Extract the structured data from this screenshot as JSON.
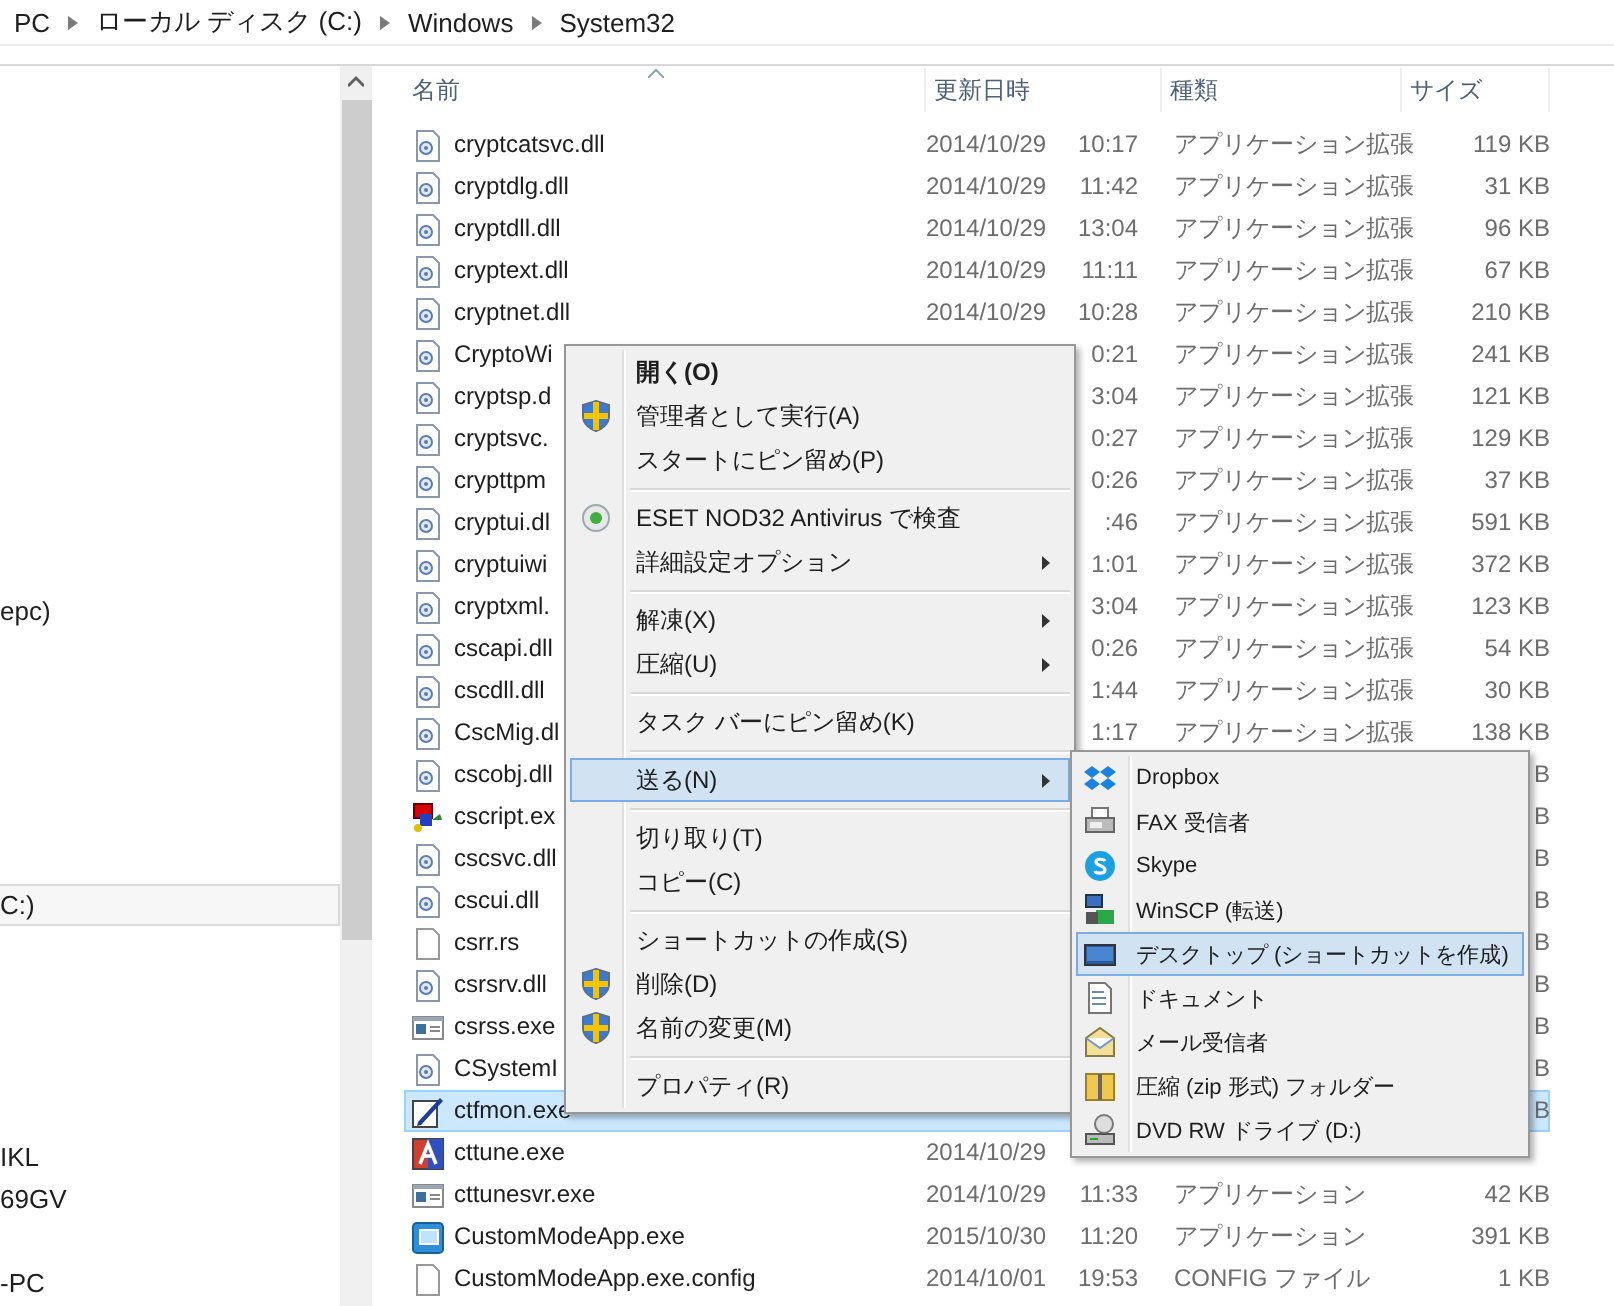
{
  "breadcrumb": [
    "PC",
    "ローカル ディスク (C:)",
    "Windows",
    "System32"
  ],
  "nav_items": [
    {
      "text": "epc)",
      "selected": false
    },
    {
      "text": "C:)",
      "selected": true
    },
    {
      "text": "IKL",
      "selected": false
    },
    {
      "text": "69GV",
      "selected": false
    },
    {
      "text": "-PC",
      "selected": false
    }
  ],
  "columns": [
    "名前",
    "更新日時",
    "種類",
    "サイズ"
  ],
  "rows": [
    {
      "kind": "dll",
      "name": "cryptcatsvc.dll",
      "day": "2014/10/29",
      "time": "10:17",
      "type": "アプリケーション拡張",
      "size": "119 KB",
      "selected": false
    },
    {
      "kind": "dll",
      "name": "cryptdlg.dll",
      "day": "2014/10/29",
      "time": "11:42",
      "type": "アプリケーション拡張",
      "size": "31 KB",
      "selected": false
    },
    {
      "kind": "dll",
      "name": "cryptdll.dll",
      "day": "2014/10/29",
      "time": "13:04",
      "type": "アプリケーション拡張",
      "size": "96 KB",
      "selected": false
    },
    {
      "kind": "dll",
      "name": "cryptext.dll",
      "day": "2014/10/29",
      "time": "11:11",
      "type": "アプリケーション拡張",
      "size": "67 KB",
      "selected": false
    },
    {
      "kind": "dll",
      "name": "cryptnet.dll",
      "day": "2014/10/29",
      "time": "10:28",
      "type": "アプリケーション拡張",
      "size": "210 KB",
      "selected": false
    },
    {
      "kind": "dll",
      "name": "CryptoWi",
      "time": "0:21",
      "type": "アプリケーション拡張",
      "size": "241 KB",
      "selected": false
    },
    {
      "kind": "dll",
      "name": "cryptsp.d",
      "time": "3:04",
      "type": "アプリケーション拡張",
      "size": "121 KB",
      "selected": false
    },
    {
      "kind": "dll",
      "name": "cryptsvc.",
      "time": "0:27",
      "type": "アプリケーション拡張",
      "size": "129 KB",
      "selected": false
    },
    {
      "kind": "dll",
      "name": "crypttpm",
      "time": "0:26",
      "type": "アプリケーション拡張",
      "size": "37 KB",
      "selected": false
    },
    {
      "kind": "dll",
      "name": "cryptui.dl",
      "time": ":46",
      "type": "アプリケーション拡張",
      "size": "591 KB",
      "selected": false
    },
    {
      "kind": "dll",
      "name": "cryptuiwi",
      "time": "1:01",
      "type": "アプリケーション拡張",
      "size": "372 KB",
      "selected": false
    },
    {
      "kind": "dll",
      "name": "cryptxml.",
      "time": "3:04",
      "type": "アプリケーション拡張",
      "size": "123 KB",
      "selected": false
    },
    {
      "kind": "dll",
      "name": "cscapi.dll",
      "time": "0:26",
      "type": "アプリケーション拡張",
      "size": "54 KB",
      "selected": false
    },
    {
      "kind": "dll",
      "name": "cscdll.dll",
      "time": "1:44",
      "type": "アプリケーション拡張",
      "size": "30 KB",
      "selected": false
    },
    {
      "kind": "dll",
      "name": "CscMig.dl",
      "time": "1:17",
      "type": "アプリケーション拡張",
      "size": "138 KB",
      "selected": false
    },
    {
      "kind": "dll",
      "name": "cscobj.dll",
      "size": "B",
      "selected": false
    },
    {
      "kind": "script",
      "name": "cscript.ex",
      "size": "B",
      "selected": false
    },
    {
      "kind": "dll",
      "name": "cscsvc.dll",
      "size": "B",
      "selected": false
    },
    {
      "kind": "dll",
      "name": "cscui.dll",
      "size": "B",
      "selected": false
    },
    {
      "kind": "blank",
      "name": "csrr.rs",
      "size": "B",
      "selected": false
    },
    {
      "kind": "dll",
      "name": "csrsrv.dll",
      "size": "B",
      "selected": false
    },
    {
      "kind": "exe",
      "name": "csrss.exe",
      "size": "B",
      "selected": false
    },
    {
      "kind": "dll",
      "name": "CSystemI",
      "size": "B",
      "selected": false
    },
    {
      "kind": "pen",
      "name": "ctfmon.exe",
      "size": "B",
      "selected": true
    },
    {
      "kind": "font",
      "name": "cttune.exe",
      "day": "2014/10/29",
      "selected": false
    },
    {
      "kind": "exe",
      "name": "cttunesvr.exe",
      "day": "2014/10/29",
      "time": "11:33",
      "type": "アプリケーション",
      "size": "42 KB",
      "selected": false
    },
    {
      "kind": "app",
      "name": "CustomModeApp.exe",
      "day": "2015/10/30",
      "time": "11:20",
      "type": "アプリケーション",
      "size": "391 KB",
      "selected": false
    },
    {
      "kind": "blank",
      "name": "CustomModeApp.exe.config",
      "day": "2014/10/01",
      "time": "19:53",
      "type": "CONFIG ファイル",
      "size": "1 KB",
      "selected": false
    }
  ],
  "context_menu": [
    {
      "kind": "plain",
      "label": "開く(O)",
      "bold": true,
      "submenu": false,
      "selected": false
    },
    {
      "kind": "shield",
      "label": "管理者として実行(A)",
      "bold": false,
      "submenu": false,
      "selected": false
    },
    {
      "kind": "plain",
      "label": "スタートにピン留め(P)",
      "bold": false,
      "submenu": false,
      "selected": false
    },
    {
      "kind": "separator"
    },
    {
      "kind": "eset",
      "label": "ESET NOD32 Antivirus で検査",
      "bold": false,
      "submenu": false,
      "selected": false
    },
    {
      "kind": "plain",
      "label": "詳細設定オプション",
      "bold": false,
      "submenu": true,
      "selected": false
    },
    {
      "kind": "separator"
    },
    {
      "kind": "plain",
      "label": "解凍(X)",
      "bold": false,
      "submenu": true,
      "selected": false
    },
    {
      "kind": "plain",
      "label": "圧縮(U)",
      "bold": false,
      "submenu": true,
      "selected": false
    },
    {
      "kind": "separator"
    },
    {
      "kind": "plain",
      "label": "タスク バーにピン留め(K)",
      "bold": false,
      "submenu": false,
      "selected": false
    },
    {
      "kind": "separator"
    },
    {
      "kind": "plain",
      "label": "送る(N)",
      "bold": false,
      "submenu": true,
      "selected": true
    },
    {
      "kind": "separator"
    },
    {
      "kind": "plain",
      "label": "切り取り(T)",
      "bold": false,
      "submenu": false,
      "selected": false
    },
    {
      "kind": "plain",
      "label": "コピー(C)",
      "bold": false,
      "submenu": false,
      "selected": false
    },
    {
      "kind": "separator"
    },
    {
      "kind": "plain",
      "label": "ショートカットの作成(S)",
      "bold": false,
      "submenu": false,
      "selected": false
    },
    {
      "kind": "shield",
      "label": "削除(D)",
      "bold": false,
      "submenu": false,
      "selected": false
    },
    {
      "kind": "shield",
      "label": "名前の変更(M)",
      "bold": false,
      "submenu": false,
      "selected": false
    },
    {
      "kind": "separator"
    },
    {
      "kind": "plain",
      "label": "プロパティ(R)",
      "bold": false,
      "submenu": false,
      "selected": false
    }
  ],
  "send_to_menu": [
    {
      "label": "Dropbox",
      "kind": "dropbox",
      "selected": false
    },
    {
      "label": "FAX 受信者",
      "kind": "fax",
      "selected": false
    },
    {
      "label": "Skype",
      "kind": "skype",
      "selected": false
    },
    {
      "label": "WinSCP (転送)",
      "kind": "winscp",
      "selected": false
    },
    {
      "label": "デスクトップ (ショートカットを作成)",
      "kind": "desktop",
      "selected": true
    },
    {
      "label": "ドキュメント",
      "kind": "document",
      "selected": false
    },
    {
      "label": "メール受信者",
      "kind": "mail",
      "selected": false
    },
    {
      "label": "圧縮 (zip 形式) フォルダー",
      "kind": "zip",
      "selected": false
    },
    {
      "label": "DVD RW ドライブ (D:)",
      "kind": "dvd",
      "selected": false
    }
  ]
}
